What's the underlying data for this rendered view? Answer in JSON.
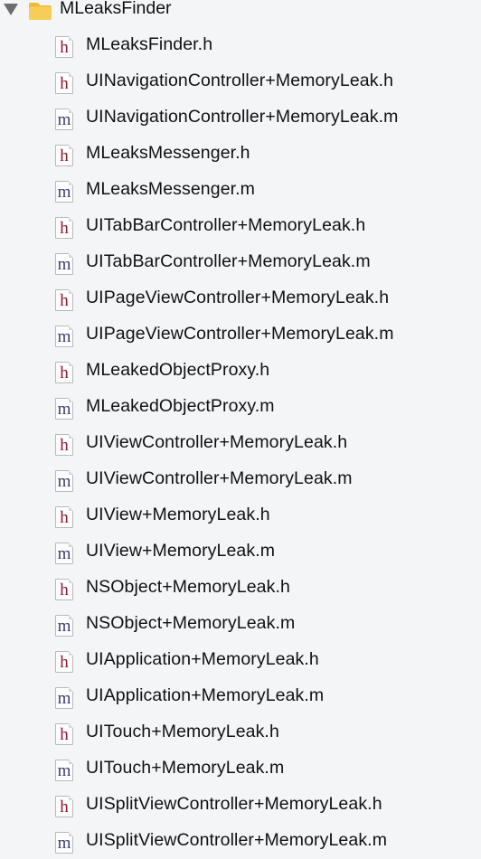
{
  "navigator": {
    "group": {
      "name": "MLeaksFinder",
      "icon": "folder-icon",
      "expanded": true
    },
    "files": [
      {
        "name": "MLeaksFinder.h",
        "type": "h"
      },
      {
        "name": "UINavigationController+MemoryLeak.h",
        "type": "h"
      },
      {
        "name": "UINavigationController+MemoryLeak.m",
        "type": "m"
      },
      {
        "name": "MLeaksMessenger.h",
        "type": "h"
      },
      {
        "name": "MLeaksMessenger.m",
        "type": "m"
      },
      {
        "name": "UITabBarController+MemoryLeak.h",
        "type": "h"
      },
      {
        "name": "UITabBarController+MemoryLeak.m",
        "type": "m"
      },
      {
        "name": "UIPageViewController+MemoryLeak.h",
        "type": "h"
      },
      {
        "name": "UIPageViewController+MemoryLeak.m",
        "type": "m"
      },
      {
        "name": "MLeakedObjectProxy.h",
        "type": "h"
      },
      {
        "name": "MLeakedObjectProxy.m",
        "type": "m"
      },
      {
        "name": "UIViewController+MemoryLeak.h",
        "type": "h"
      },
      {
        "name": "UIViewController+MemoryLeak.m",
        "type": "m"
      },
      {
        "name": "UIView+MemoryLeak.h",
        "type": "h"
      },
      {
        "name": "UIView+MemoryLeak.m",
        "type": "m"
      },
      {
        "name": "NSObject+MemoryLeak.h",
        "type": "h"
      },
      {
        "name": "NSObject+MemoryLeak.m",
        "type": "m"
      },
      {
        "name": "UIApplication+MemoryLeak.h",
        "type": "h"
      },
      {
        "name": "UIApplication+MemoryLeak.m",
        "type": "m"
      },
      {
        "name": "UITouch+MemoryLeak.h",
        "type": "h"
      },
      {
        "name": "UITouch+MemoryLeak.m",
        "type": "m"
      },
      {
        "name": "UISplitViewController+MemoryLeak.h",
        "type": "h"
      },
      {
        "name": "UISplitViewController+MemoryLeak.m",
        "type": "m"
      }
    ]
  },
  "colors": {
    "background": "#f4f5f7",
    "header_glyph": "#8a1c2e",
    "impl_glyph": "#3a3f6e",
    "folder": "#f3c14b"
  }
}
